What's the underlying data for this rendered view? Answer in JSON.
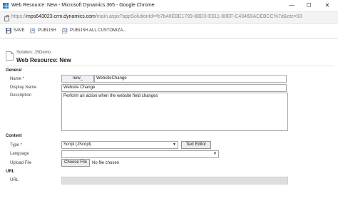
{
  "window": {
    "title": "Web Resource: New - Microsoft Dynamics 365 - Google Chrome",
    "minimize": "—",
    "maximize": "☐",
    "close": "✕"
  },
  "address_bar": {
    "scheme": "https://",
    "host": "mps643023.crm.dynamics.com",
    "path": "/main.aspx?appSolutionId=%7b48EBE1799-8BD3-E611-80EF-C4346BACEBCC%7d&etc=93"
  },
  "command_bar": {
    "save": "SAVE",
    "publish": "PUBLISH",
    "publish_all": "PUBLISH ALL CUSTOMIZA..."
  },
  "header": {
    "solution": "Solution: JSDemo",
    "title": "Web Resource: New"
  },
  "general": {
    "section_title": "General",
    "name_label": "Name",
    "name_required": "*",
    "name_prefix": "new_",
    "name_value": "WebsiteChange",
    "display_name_label": "Display Name",
    "display_name_value": "Website Change",
    "description_label": "Description",
    "description_value": "Perform an action when the website field changes"
  },
  "content": {
    "section_title": "Content",
    "type_label": "Type",
    "type_required": "*",
    "type_value": "Script (JScript)",
    "text_editor_button": "Text Editor",
    "language_label": "Language",
    "language_value": "",
    "upload_label": "Upload File",
    "choose_file_button": "Choose File",
    "no_file_text": "No file chosen"
  },
  "url_section": {
    "section_title": "URL",
    "url_label": "URL",
    "url_value": ""
  },
  "colors": {
    "required": "#d40000",
    "dynamics_blue": "#1e7ad6"
  }
}
